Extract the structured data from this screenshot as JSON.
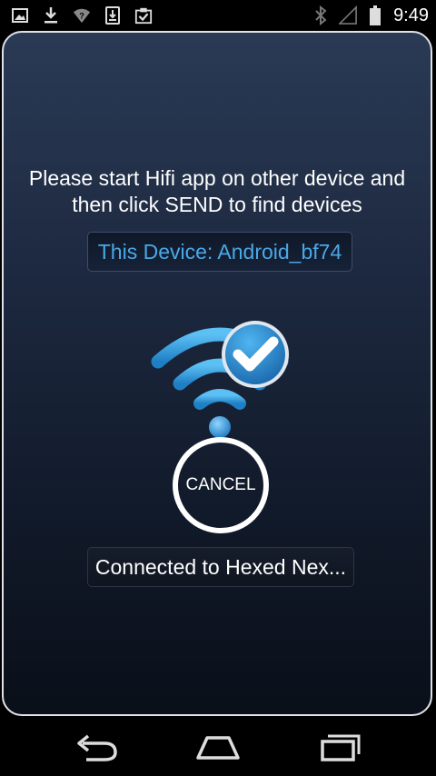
{
  "status_bar": {
    "time": "9:49",
    "left_icons": [
      "image-icon",
      "download-icon",
      "wifi-question-icon",
      "sim-download-icon",
      "clipboard-check-icon"
    ],
    "right_icons": [
      "bluetooth-icon",
      "signal-icon",
      "battery-icon"
    ]
  },
  "dialog": {
    "instruction_line1": "Please start Hifi app on other device and",
    "instruction_line2": "then click SEND to find devices",
    "device_label": "This Device: Android_bf74",
    "wifi_icon": "wifi-check-icon",
    "cancel_label": "CANCEL",
    "connection_status": "Connected to Hexed Nex..."
  },
  "colors": {
    "accent": "#4aa8e6",
    "card_top": "#2a3a55",
    "card_bottom": "#0a0f19",
    "border": "#dfe3e8"
  },
  "nav_bar": {
    "icons": [
      "back-icon",
      "home-icon",
      "recent-apps-icon"
    ]
  }
}
